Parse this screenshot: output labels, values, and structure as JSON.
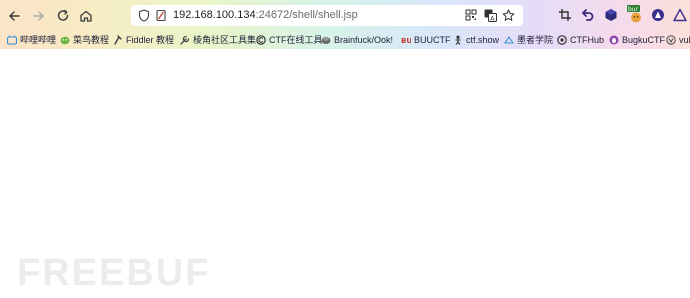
{
  "browser": {
    "url_host": "192.168.100.134",
    "url_path": ":24672/shell/shell.jsp",
    "toolbar_icons": [
      "back-icon",
      "forward-icon",
      "reload-icon",
      "home-icon"
    ],
    "url_icons": [
      "shield-icon",
      "page-info-icon",
      "qr-code-icon",
      "translate-icon",
      "star-icon"
    ],
    "extension_icons": [
      "crop-icon",
      "undo-icon",
      "cube-icon",
      "burp-extension-icon",
      "circle-extension-icon",
      "warning-extension-icon"
    ],
    "burp_badge": "bur"
  },
  "bookmarks": [
    {
      "label": "哔哩哔哩",
      "icon": "bilibili-icon",
      "color": "#2f8fd8"
    },
    {
      "label": "菜鸟教程",
      "icon": "runoob-icon",
      "color": "#4a9c3a"
    },
    {
      "label": "Fiddler 教程",
      "icon": "fiddler-icon",
      "color": "#333333"
    },
    {
      "label": "棱角社区工具集",
      "icon": "tool-icon",
      "color": "#444444"
    },
    {
      "label": "CTF在线工具",
      "icon": "ctf-tools-icon",
      "color": "#333333"
    },
    {
      "label": "Brainfuck/Ook!",
      "icon": "brainfuck-icon",
      "color": "#555555"
    },
    {
      "label": "BUUCTF",
      "icon": "buuctf-icon",
      "color": "#c0392b"
    },
    {
      "label": "ctf.show",
      "icon": "ctfshow-icon",
      "color": "#333333"
    },
    {
      "label": "墨者学院",
      "icon": "mozhe-icon",
      "color": "#3a8fd0"
    },
    {
      "label": "CTFHub",
      "icon": "ctfhub-icon",
      "color": "#333333"
    },
    {
      "label": "BugkuCTF",
      "icon": "bugku-icon",
      "color": "#8e44ad"
    },
    {
      "label": "vul",
      "icon": "vulhub-icon",
      "color": "#555555"
    }
  ],
  "watermark": "FREEBUF",
  "colors": {
    "text": "#22223a",
    "url_path": "#6b6b6b",
    "watermark": "#ececec"
  }
}
